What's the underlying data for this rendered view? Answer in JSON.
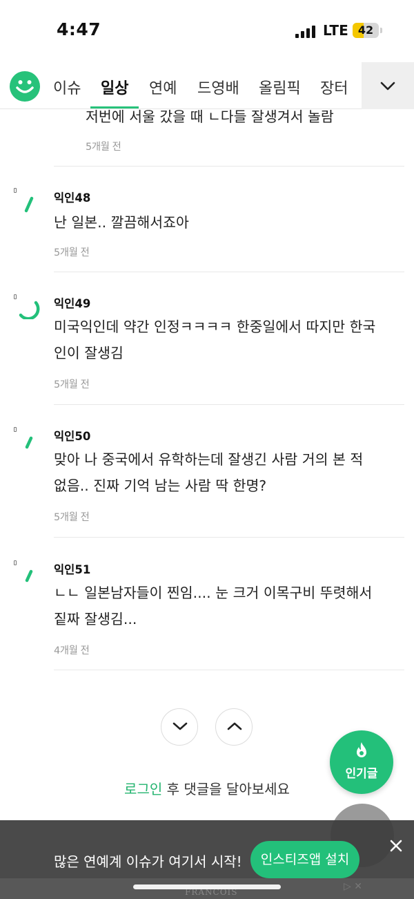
{
  "status_bar": {
    "time": "4:47",
    "network": "LTE",
    "battery": "42",
    "battery_level": 0.42,
    "battery_color": "#f4c700"
  },
  "nav": {
    "logo_icon": "smile-logo-icon",
    "tabs": [
      {
        "label": "이슈",
        "active": false
      },
      {
        "label": "일상",
        "active": true
      },
      {
        "label": "연예",
        "active": false
      },
      {
        "label": "드영배",
        "active": false
      },
      {
        "label": "올림픽",
        "active": false
      },
      {
        "label": "장터",
        "active": false
      }
    ],
    "more_icon": "chevron-down-icon"
  },
  "partial_comment": {
    "text": "저번에 서울 갔을 때 ㄴ다들 잘생겨서 놀람",
    "time": "5개월 전"
  },
  "comments": [
    {
      "author": "익인48",
      "lines": [
        "난 일본.. 깔끔해서죠아"
      ],
      "time": "5개월 전"
    },
    {
      "author": "익인49",
      "lines": [
        "미국익인데 약간 인정ㅋㅋㅋㅋ 한중일에서 따지만 한국",
        "인이 잘생김"
      ],
      "time": "5개월 전"
    },
    {
      "author": "익인50",
      "lines": [
        "맞아 나 중국에서 유학하는데 잘생긴 사람 거의 본 적",
        "없음.. 진짜 기억 남는 사람 딱 한명?"
      ],
      "time": "5개월 전"
    },
    {
      "author": "익인51",
      "lines": [
        "ㄴㄴ 일본남자들이 찐임.... 눈 크거 이목구비 뚜렷해서",
        "짙짜 잘생김..."
      ],
      "time": "4개월 전"
    }
  ],
  "controls": {
    "down_icon": "chevron-down-icon",
    "up_icon": "chevron-up-icon",
    "hot_label": "인기글",
    "hot_icon": "flame-icon"
  },
  "login_prompt": {
    "link": "로그인",
    "rest": " 후 댓글을 달아보세요"
  },
  "banner": {
    "text": "많은 연예계 이슈가 여기서 시작!",
    "button": "인스티즈앱 설치",
    "close_icon": "close-icon",
    "ad_logo": "FRANCOIS"
  },
  "colors": {
    "accent": "#23c07a",
    "link": "#23b46f",
    "banner_bg": "#3c3c3c"
  }
}
